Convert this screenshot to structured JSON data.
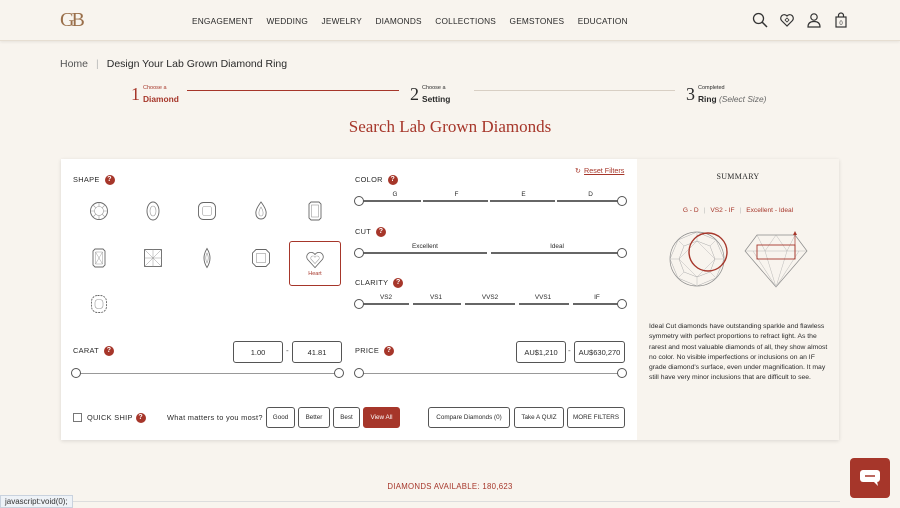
{
  "header": {
    "logo": "GB",
    "nav": [
      "ENGAGEMENT",
      "WEDDING",
      "JEWELRY",
      "DIAMONDS",
      "COLLECTIONS",
      "GEMSTONES",
      "EDUCATION"
    ]
  },
  "breadcrumb": {
    "home": "Home",
    "current": "Design Your Lab Grown Diamond Ring"
  },
  "steps": [
    {
      "num": "1",
      "small": "Choose a",
      "big": "Diamond",
      "extra": ""
    },
    {
      "num": "2",
      "small": "Choose a",
      "big": "Setting",
      "extra": ""
    },
    {
      "num": "3",
      "small": "Completed",
      "big": "Ring",
      "extra": "(Select Size)"
    }
  ],
  "page_title": "Search Lab Grown Diamonds",
  "filters": {
    "reset": "Reset Filters",
    "shape_label": "SHAPE",
    "selected_shape": "Heart",
    "color_label": "COLOR",
    "color_grades": [
      "G",
      "F",
      "E",
      "D"
    ],
    "cut_label": "CUT",
    "cut_grades": [
      "Excellent",
      "Ideal"
    ],
    "clarity_label": "CLARITY",
    "clarity_grades": [
      "VS2",
      "VS1",
      "VVS2",
      "VVS1",
      "IF"
    ],
    "carat_label": "CARAT",
    "carat_min": "1.00",
    "carat_max": "41.81",
    "price_label": "PRICE",
    "price_min": "AU$1,210",
    "price_max": "AU$630,270",
    "dash": "-",
    "quick_ship": "QUICK SHIP",
    "matters": "What matters to you most?",
    "matters_options": [
      "Good",
      "Better",
      "Best",
      "View All"
    ],
    "compare": "Compare Diamonds (0)",
    "quiz": "Take A QUIZ",
    "more": "MORE FILTERS"
  },
  "summary": {
    "title": "SUMMARY",
    "color": "G - D",
    "clarity": "VS2 - IF",
    "cut": "Excellent - Ideal",
    "text": "Ideal Cut diamonds have outstanding sparkle and flawless symmetry with perfect proportions to refract light. As the rarest and most valuable diamonds of all, they show almost no color. No visible imperfections or inclusions on an IF grade diamond's surface, even under magnification. It may still have very minor inclusions that are difficult to see."
  },
  "available": "DIAMONDS AVAILABLE: 180,623",
  "status_bar": "javascript:void(0);",
  "colors": {
    "accent": "#a6362a",
    "background": "#f8f4ee"
  }
}
